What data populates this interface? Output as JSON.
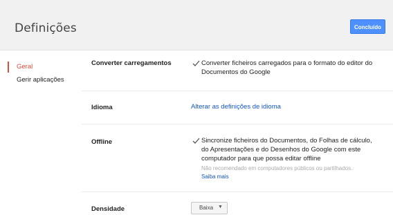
{
  "header": {
    "title": "Definições",
    "done_label": "Concluído"
  },
  "sidebar": {
    "items": [
      {
        "label": "Geral"
      },
      {
        "label": "Gerir aplicações"
      }
    ]
  },
  "settings": {
    "convert": {
      "label": "Converter carregamentos",
      "option_line1": "Converter ficheiros carregados para o formato do editor do",
      "option_line2": "Documentos do Google",
      "checked": true
    },
    "language": {
      "label": "Idioma",
      "link": "Alterar as definições de idioma"
    },
    "offline": {
      "label": "Offline",
      "option_line1": "Sincronize ficheiros do Documentos, do Folhas de cálculo,",
      "option_line2": "do Apresentações e do Desenhos do Google com este",
      "option_line3": "computador para que possa editar offline",
      "hint": "Não recomendado em computadores públicos ou partilhados.",
      "learn_more": "Saiba mais",
      "checked": true
    },
    "density": {
      "label": "Densidade",
      "selected": "Baixa"
    }
  },
  "colors": {
    "accent": "#4d90fe",
    "active_nav": "#dd4b39",
    "link": "#1155cc"
  }
}
